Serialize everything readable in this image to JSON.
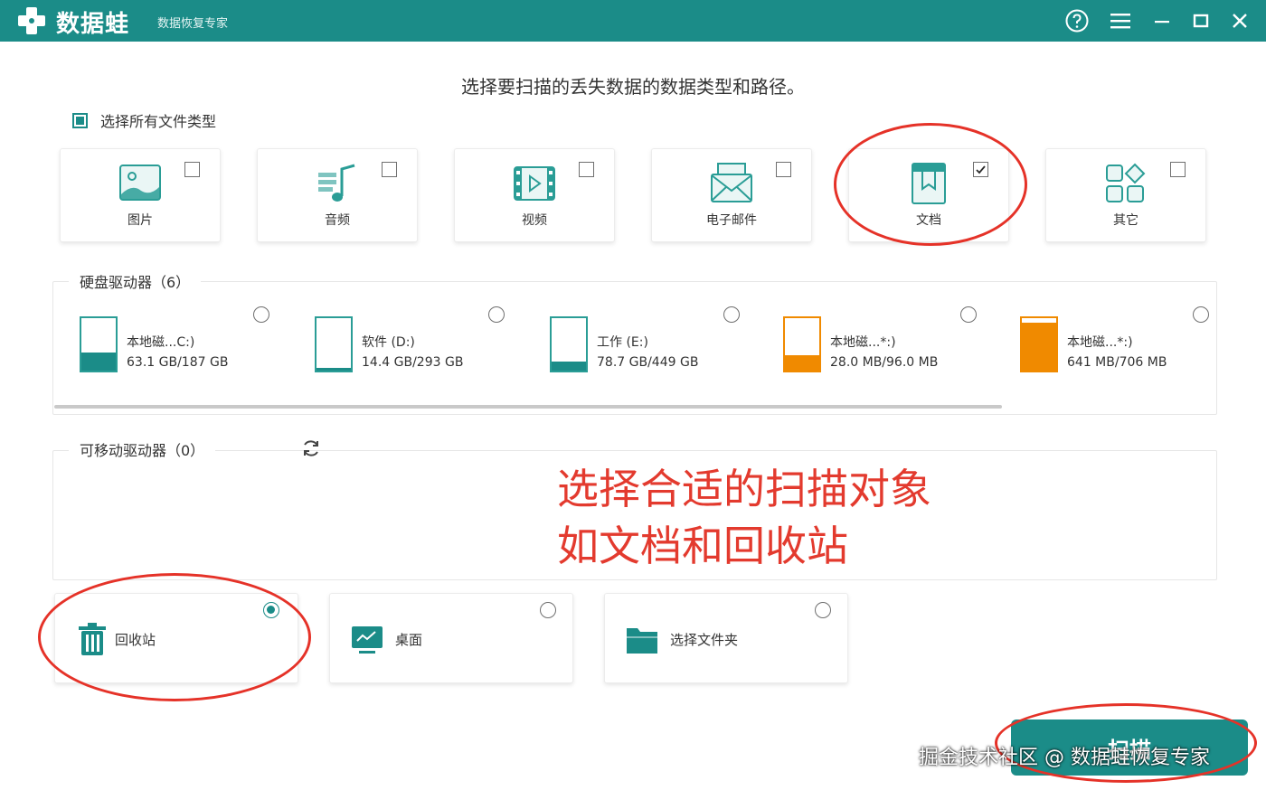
{
  "app": {
    "name": "数据蛙",
    "subtitle": "数据恢复专家"
  },
  "window_controls": [
    "help-icon",
    "menu-icon",
    "minimize-icon",
    "maximize-icon",
    "close-icon"
  ],
  "main_title": "选择要扫描的丢失数据的数据类型和路径。",
  "select_all": {
    "label": "选择所有文件类型",
    "state": "partial"
  },
  "file_types": [
    {
      "label": "图片",
      "icon": "image-icon",
      "checked": false
    },
    {
      "label": "音频",
      "icon": "audio-icon",
      "checked": false
    },
    {
      "label": "视频",
      "icon": "video-icon",
      "checked": false
    },
    {
      "label": "电子邮件",
      "icon": "email-icon",
      "checked": false
    },
    {
      "label": "文档",
      "icon": "document-icon",
      "checked": true
    },
    {
      "label": "其它",
      "icon": "other-icon",
      "checked": false
    }
  ],
  "hard_drives": {
    "title": "硬盘驱动器（6）",
    "items": [
      {
        "name": "本地磁...C:)",
        "size": "63.1 GB/187 GB",
        "fill": 0.34,
        "color": "#1b8c88",
        "selected": false
      },
      {
        "name": "软件 (D:)",
        "size": "14.4 GB/293 GB",
        "fill": 0.05,
        "color": "#1b8c88",
        "selected": false
      },
      {
        "name": "工作 (E:)",
        "size": "78.7 GB/449 GB",
        "fill": 0.18,
        "color": "#1b8c88",
        "selected": false
      },
      {
        "name": "本地磁...*:)",
        "size": "28.0 MB/96.0 MB",
        "fill": 0.29,
        "color": "#f08a00",
        "selected": false
      },
      {
        "name": "本地磁...*:)",
        "size": "641 MB/706 MB",
        "fill": 0.91,
        "color": "#f08a00",
        "selected": false
      }
    ]
  },
  "removable_drives": {
    "title": "可移动驱动器（0）"
  },
  "annotation": {
    "line1": "选择合适的扫描对象",
    "line2": "如文档和回收站"
  },
  "locations": [
    {
      "label": "回收站",
      "icon": "recycle-bin-icon",
      "selected": true
    },
    {
      "label": "桌面",
      "icon": "desktop-icon",
      "selected": false
    },
    {
      "label": "选择文件夹",
      "icon": "folder-icon",
      "selected": false
    }
  ],
  "scan_button": {
    "label": "扫描"
  },
  "watermark": "掘金技术社区 @ 数据蛙恢复专家",
  "colors": {
    "accent": "#1b8c88",
    "warning": "#f08a00",
    "annotation": "#e33a2e"
  }
}
